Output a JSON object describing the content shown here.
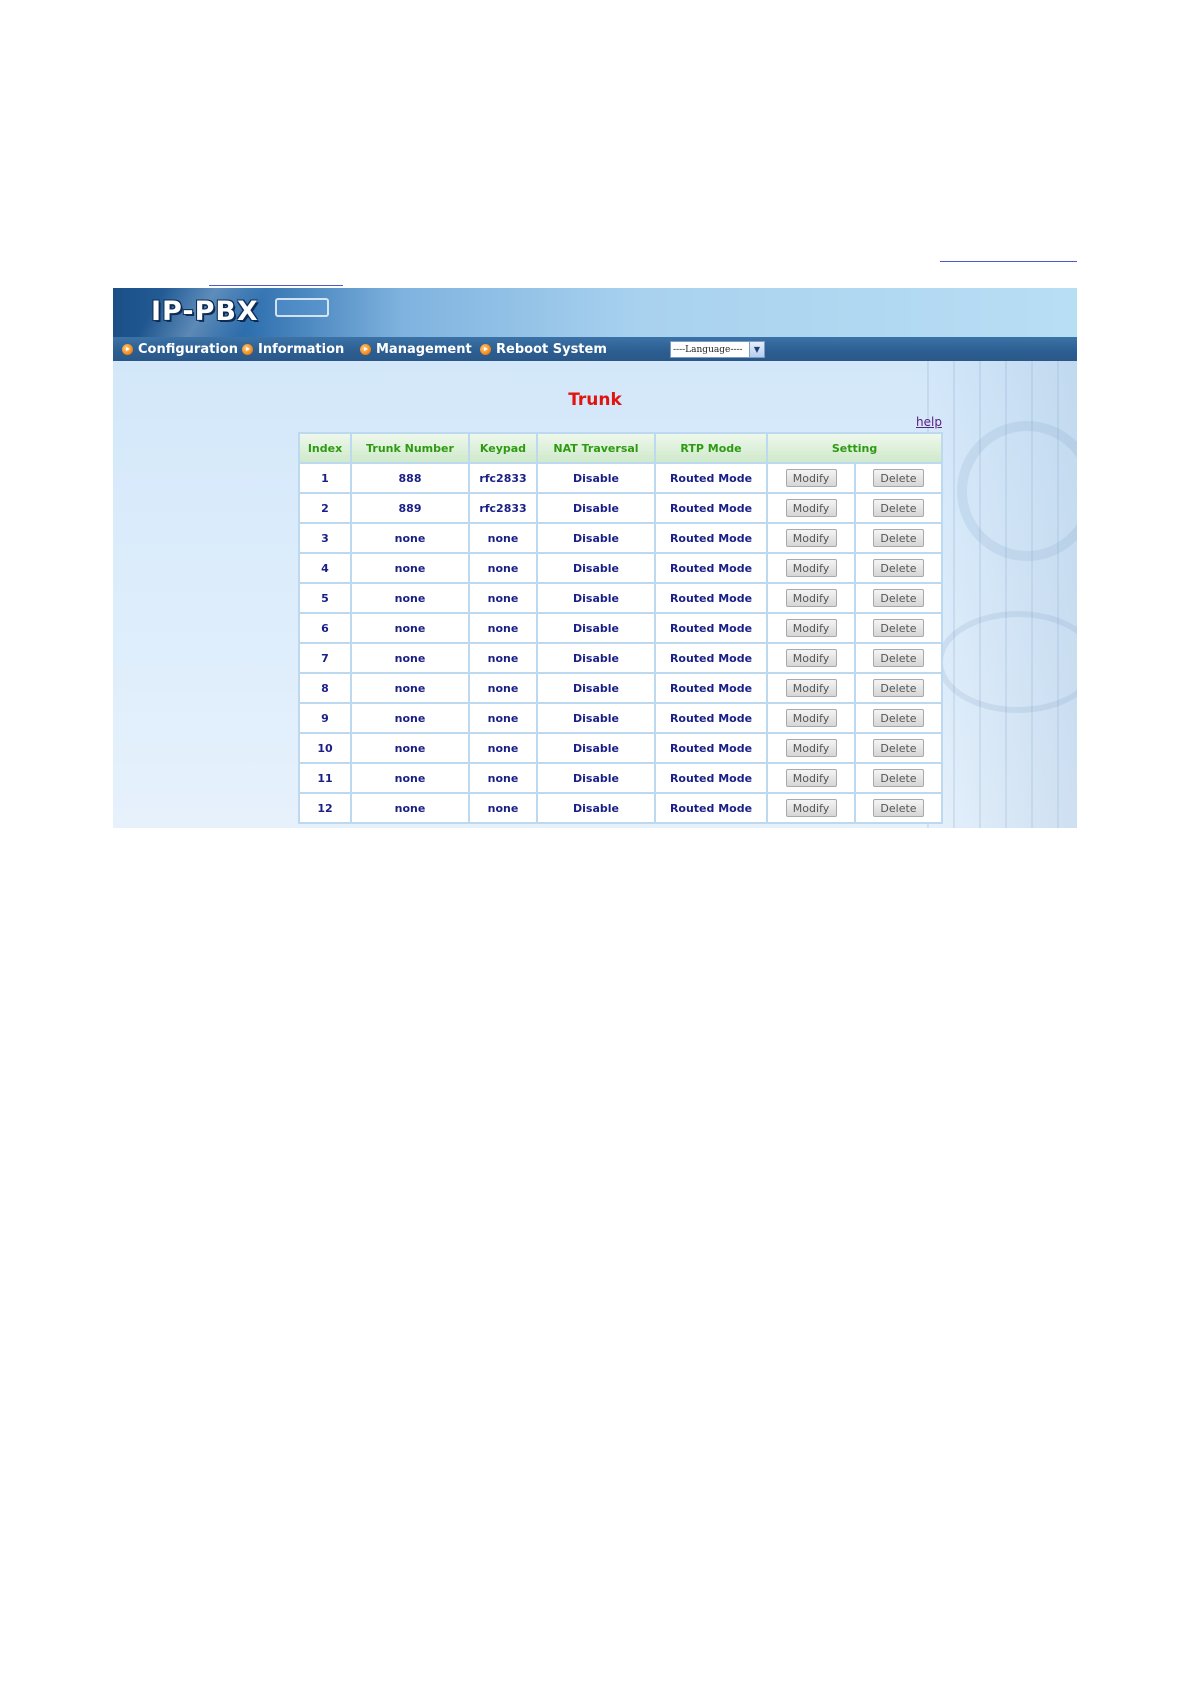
{
  "app": {
    "logo": "IP-PBX"
  },
  "menu": {
    "items": [
      {
        "label": "Configuration"
      },
      {
        "label": "Information"
      },
      {
        "label": "Management"
      },
      {
        "label": "Reboot System"
      }
    ],
    "language_select": {
      "value": "----Language----"
    }
  },
  "page": {
    "title": "Trunk",
    "help_label": "help"
  },
  "table": {
    "headers": [
      "Index",
      "Trunk Number",
      "Keypad",
      "NAT Traversal",
      "RTP Mode",
      "Setting"
    ],
    "modify_label": "Modify",
    "delete_label": "Delete",
    "rows": [
      {
        "index": "1",
        "trunk_number": "888",
        "keypad": "rfc2833",
        "nat": "Disable",
        "rtp": "Routed Mode"
      },
      {
        "index": "2",
        "trunk_number": "889",
        "keypad": "rfc2833",
        "nat": "Disable",
        "rtp": "Routed Mode"
      },
      {
        "index": "3",
        "trunk_number": "none",
        "keypad": "none",
        "nat": "Disable",
        "rtp": "Routed Mode"
      },
      {
        "index": "4",
        "trunk_number": "none",
        "keypad": "none",
        "nat": "Disable",
        "rtp": "Routed Mode"
      },
      {
        "index": "5",
        "trunk_number": "none",
        "keypad": "none",
        "nat": "Disable",
        "rtp": "Routed Mode"
      },
      {
        "index": "6",
        "trunk_number": "none",
        "keypad": "none",
        "nat": "Disable",
        "rtp": "Routed Mode"
      },
      {
        "index": "7",
        "trunk_number": "none",
        "keypad": "none",
        "nat": "Disable",
        "rtp": "Routed Mode"
      },
      {
        "index": "8",
        "trunk_number": "none",
        "keypad": "none",
        "nat": "Disable",
        "rtp": "Routed Mode"
      },
      {
        "index": "9",
        "trunk_number": "none",
        "keypad": "none",
        "nat": "Disable",
        "rtp": "Routed Mode"
      },
      {
        "index": "10",
        "trunk_number": "none",
        "keypad": "none",
        "nat": "Disable",
        "rtp": "Routed Mode"
      },
      {
        "index": "11",
        "trunk_number": "none",
        "keypad": "none",
        "nat": "Disable",
        "rtp": "Routed Mode"
      },
      {
        "index": "12",
        "trunk_number": "none",
        "keypad": "none",
        "nat": "Disable",
        "rtp": "Routed Mode"
      }
    ]
  }
}
